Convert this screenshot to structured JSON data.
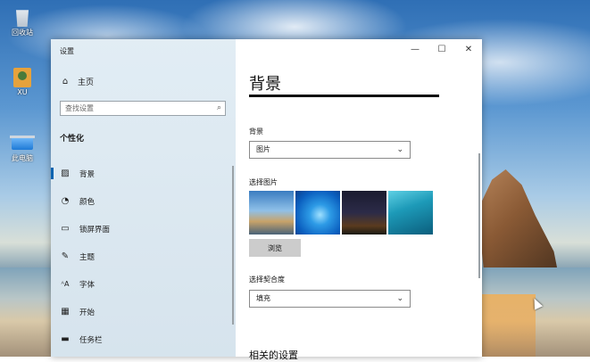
{
  "desktop": {
    "icons": [
      {
        "label": "回收站",
        "icon": "recycle-bin-icon"
      },
      {
        "label": "XU",
        "icon": "user-folder-icon"
      },
      {
        "label": "此电脑",
        "icon": "computer-icon"
      }
    ]
  },
  "window": {
    "title": "设置",
    "controls": {
      "minimize": "—",
      "maximize": "☐",
      "close": "✕"
    }
  },
  "sidebar": {
    "home_label": "主页",
    "search_placeholder": "查找设置",
    "section_title": "个性化",
    "items": [
      {
        "label": "背景",
        "icon": "picture-icon",
        "active": true
      },
      {
        "label": "颜色",
        "icon": "palette-icon",
        "active": false
      },
      {
        "label": "锁屏界面",
        "icon": "lock-screen-icon",
        "active": false
      },
      {
        "label": "主题",
        "icon": "theme-brush-icon",
        "active": false
      },
      {
        "label": "字体",
        "icon": "font-icon",
        "active": false
      },
      {
        "label": "开始",
        "icon": "start-grid-icon",
        "active": false
      },
      {
        "label": "任务栏",
        "icon": "taskbar-icon",
        "active": false
      }
    ]
  },
  "content": {
    "page_title": "背景",
    "background_label": "背景",
    "background_value": "图片",
    "choose_picture_label": "选择图片",
    "browse_label": "浏览",
    "fit_label": "选择契合度",
    "fit_value": "填充",
    "related_settings": "相关的设置"
  },
  "colors": {
    "accent": "#0a64b0",
    "sidebar_bg": "#dce8f0",
    "button_bg": "#cccccc"
  }
}
